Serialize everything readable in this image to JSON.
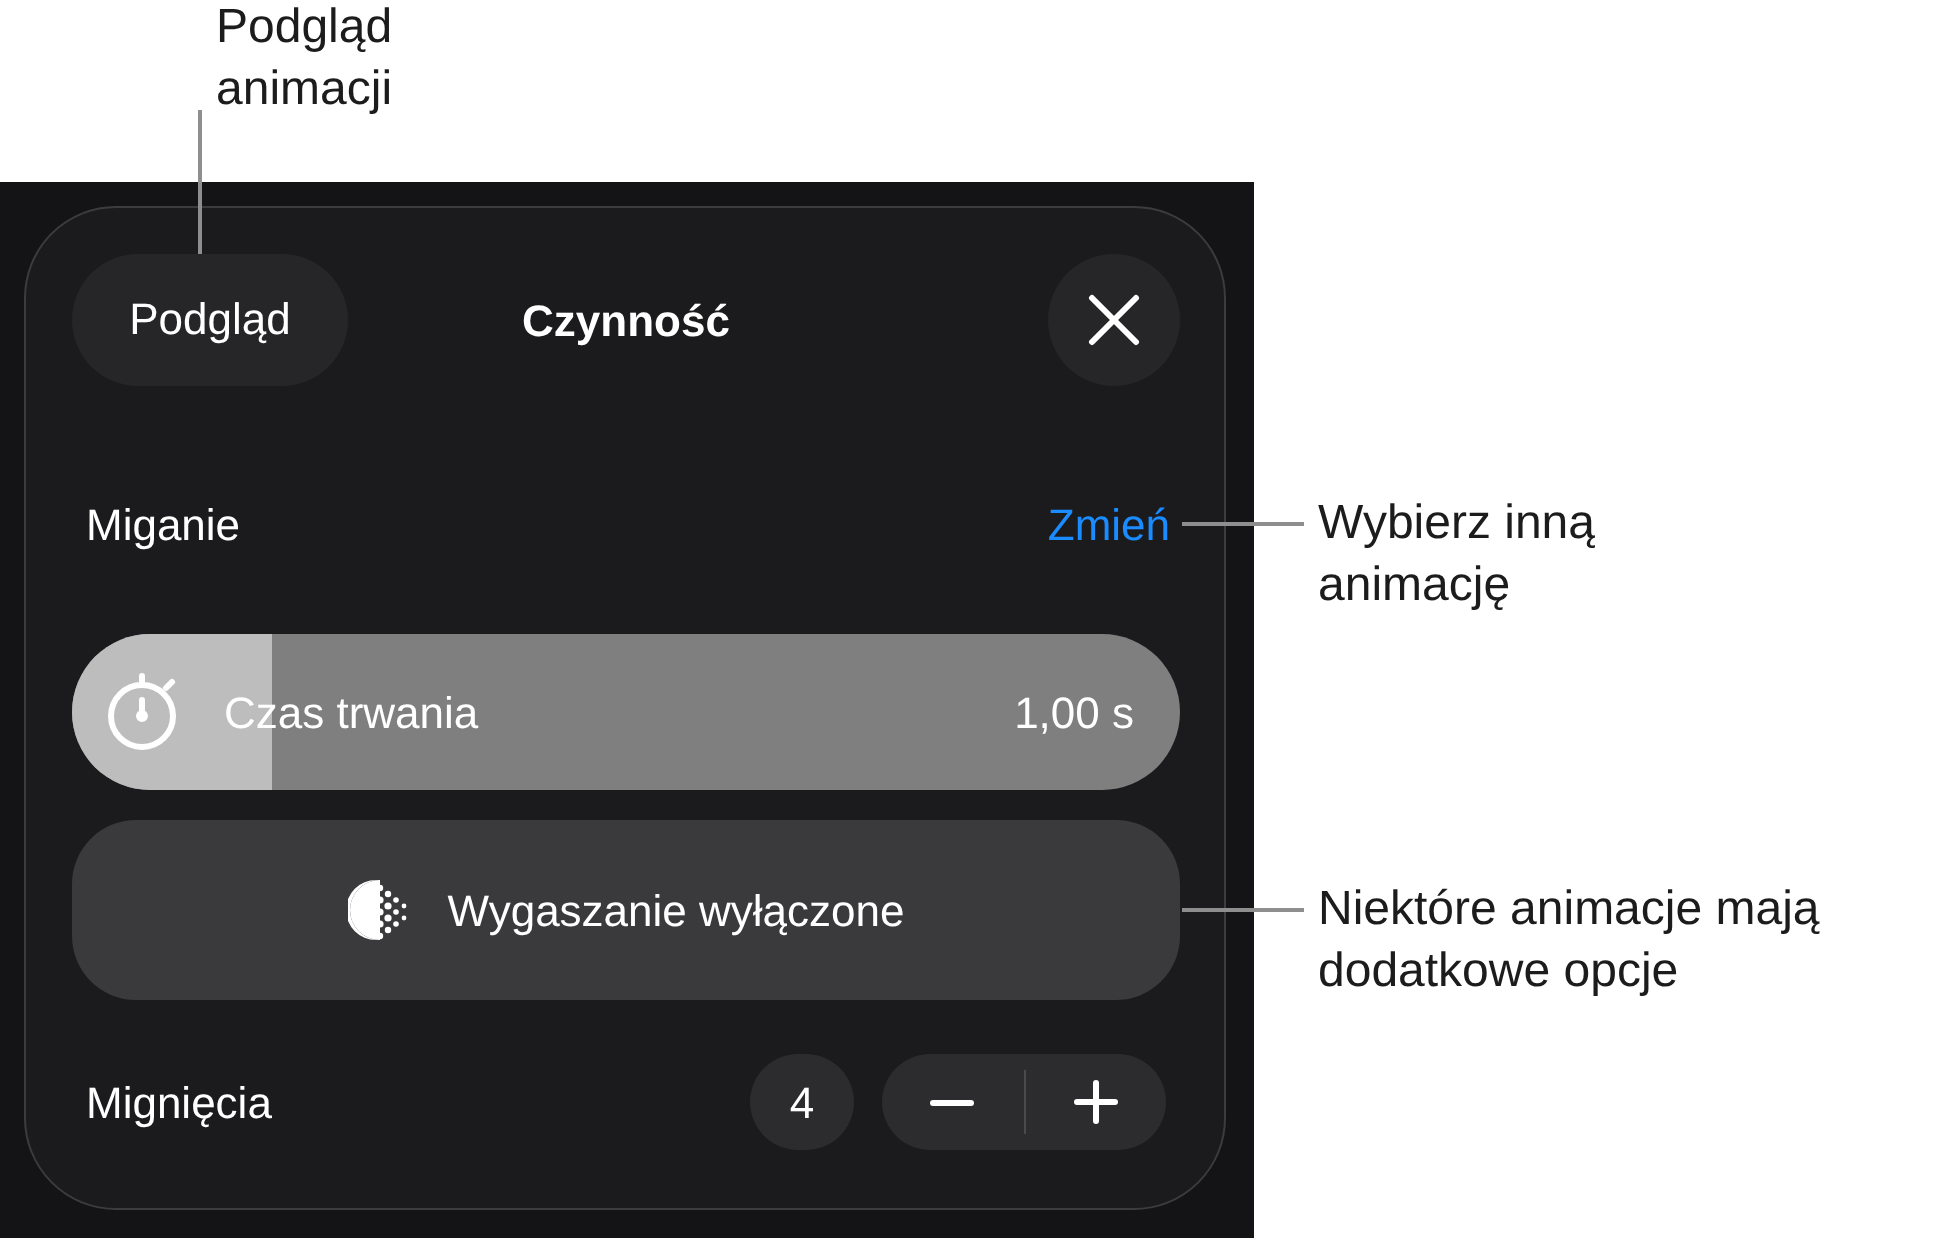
{
  "annotations": {
    "preview": "Podgląd animacji",
    "change": "Wybierz inną animację",
    "options": "Niektóre animacje mają dodatkowe opcje"
  },
  "panel": {
    "preview_button": "Podgląd",
    "title": "Czynność",
    "animation": {
      "name": "Miganie",
      "change_link": "Zmień"
    },
    "duration": {
      "label": "Czas trwania",
      "value": "1,00 s",
      "level": 0.18
    },
    "fade_button": "Wygaszanie wyłączone",
    "repeats": {
      "label": "Mignięcia",
      "value": "4"
    }
  }
}
